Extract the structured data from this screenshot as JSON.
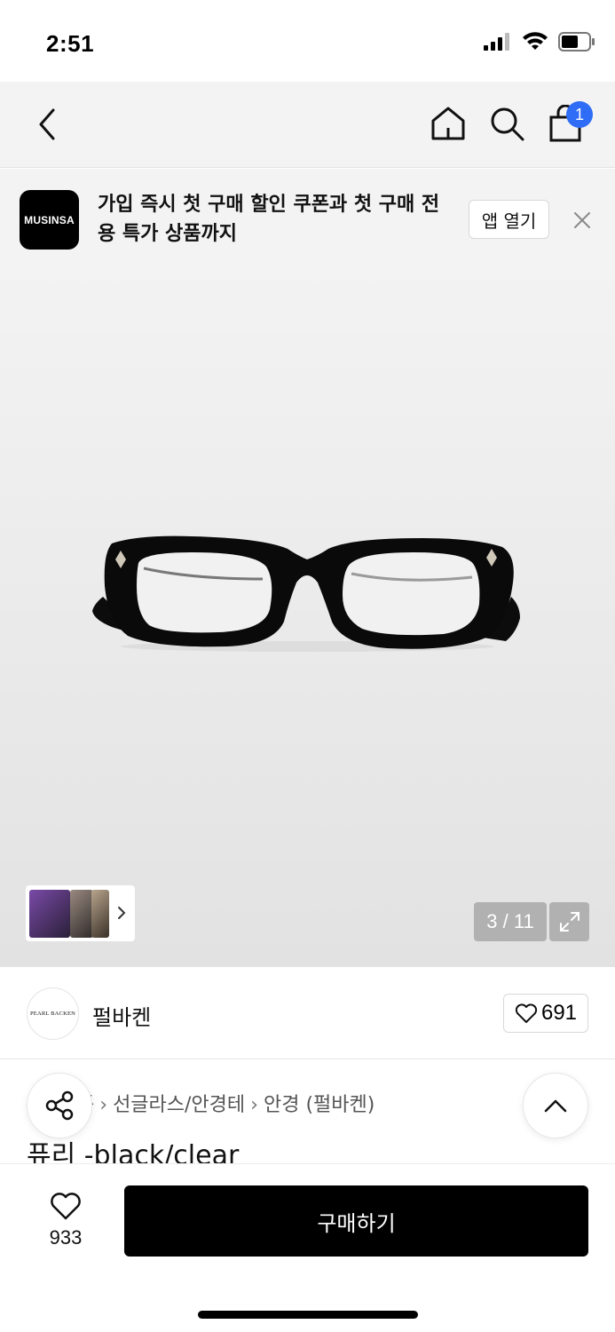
{
  "status": {
    "time": "2:51"
  },
  "nav": {
    "cart_count": "1"
  },
  "banner": {
    "logo_text": "MUSINSA",
    "message": "가입 즉시 첫 구매 할인 쿠폰과 첫 구매 전용 특가 상품까지",
    "open_label": "앱 열기"
  },
  "gallery": {
    "counter": "3 / 11"
  },
  "brand": {
    "logo_text": "PEARL BACKEN",
    "name": "펄바켄",
    "likes": "691"
  },
  "breadcrumb": [
    "품",
    "선글라스/안경테",
    "안경 (펄바켄)"
  ],
  "product": {
    "title": "퓨리 -black/clear"
  },
  "bottom": {
    "wish_count": "933",
    "buy_label": "구매하기"
  },
  "colors": {
    "accent": "#2f6df6",
    "buy_button": "#000000"
  },
  "icons": [
    "back-icon",
    "home-icon",
    "search-icon",
    "cart-icon",
    "close-icon",
    "expand-icon",
    "heart-icon",
    "share-icon",
    "chevron-up-icon",
    "chevron-right-icon"
  ]
}
